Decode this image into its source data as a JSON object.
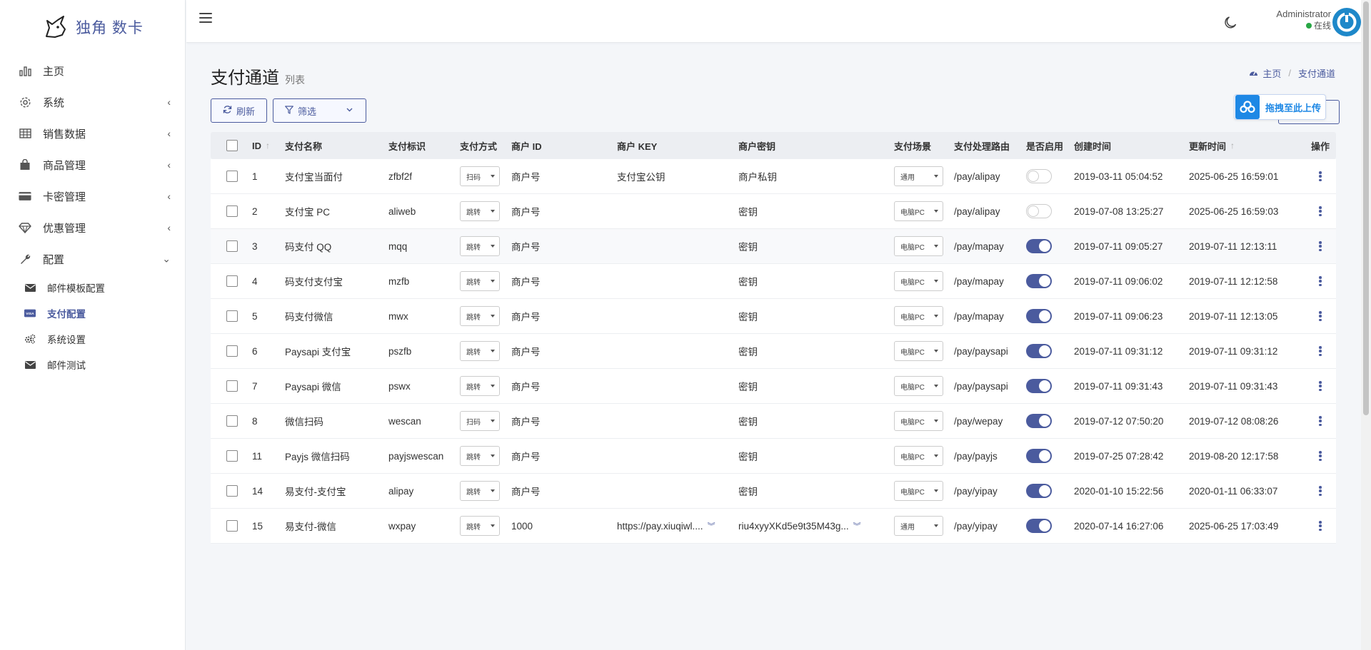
{
  "brand": {
    "name": "独角 数卡"
  },
  "sidebar": {
    "items": [
      {
        "label": "主页",
        "icon": "bar-chart-icon",
        "has_children": false
      },
      {
        "label": "系统",
        "icon": "gear-icon",
        "has_children": true
      },
      {
        "label": "销售数据",
        "icon": "table-icon",
        "has_children": true
      },
      {
        "label": "商品管理",
        "icon": "shopping-bag-icon",
        "has_children": true
      },
      {
        "label": "卡密管理",
        "icon": "credit-card-icon",
        "has_children": true
      },
      {
        "label": "优惠管理",
        "icon": "diamond-icon",
        "has_children": true
      },
      {
        "label": "配置",
        "icon": "wrench-icon",
        "has_children": true,
        "expanded": true
      }
    ],
    "sub_items": [
      {
        "label": "邮件模板配置",
        "icon": "envelope-icon"
      },
      {
        "label": "支付配置",
        "icon": "visa-card-icon",
        "active": true
      },
      {
        "label": "系统设置",
        "icon": "cogs-icon"
      },
      {
        "label": "邮件测试",
        "icon": "envelope-icon"
      }
    ]
  },
  "header": {
    "user_name": "Administrator",
    "user_status": "在线"
  },
  "page": {
    "title": "支付通道",
    "subtitle": "列表",
    "breadcrumb": {
      "home": "主页",
      "current": "支付通道"
    },
    "refresh_label": "刷新",
    "filter_label": "筛选",
    "upload_label": "拖拽至此上传"
  },
  "table": {
    "columns": {
      "id": "ID",
      "name": "支付名称",
      "ident": "支付标识",
      "method": "支付方式",
      "mid": "商户 ID",
      "mkey": "商户 KEY",
      "msec": "商户密钥",
      "scene": "支付场景",
      "route": "支付处理路由",
      "enabled": "是否启用",
      "created": "创建时间",
      "updated": "更新时间",
      "ops": "操作"
    },
    "rows": [
      {
        "id": "1",
        "name": "支付宝当面付",
        "ident": "zfbf2f",
        "method": "扫码",
        "mid": "商户号",
        "mkey": "支付宝公钥",
        "msec": "商户私钥",
        "scene": "通用",
        "route": "/pay/alipay",
        "enabled": false,
        "created": "2019-03-11 05:04:52",
        "updated": "2025-06-25 16:59:01"
      },
      {
        "id": "2",
        "name": "支付宝 PC",
        "ident": "aliweb",
        "method": "跳转",
        "mid": "商户号",
        "mkey": "",
        "msec": "密钥",
        "scene": "电脑PC",
        "route": "/pay/alipay",
        "enabled": false,
        "created": "2019-07-08 13:25:27",
        "updated": "2025-06-25 16:59:03"
      },
      {
        "id": "3",
        "name": "码支付 QQ",
        "ident": "mqq",
        "method": "跳转",
        "mid": "商户号",
        "mkey": "",
        "msec": "密钥",
        "scene": "电脑PC",
        "route": "/pay/mapay",
        "enabled": true,
        "created": "2019-07-11 09:05:27",
        "updated": "2019-07-11 12:13:11"
      },
      {
        "id": "4",
        "name": "码支付支付宝",
        "ident": "mzfb",
        "method": "跳转",
        "mid": "商户号",
        "mkey": "",
        "msec": "密钥",
        "scene": "电脑PC",
        "route": "/pay/mapay",
        "enabled": true,
        "created": "2019-07-11 09:06:02",
        "updated": "2019-07-11 12:12:58"
      },
      {
        "id": "5",
        "name": "码支付微信",
        "ident": "mwx",
        "method": "跳转",
        "mid": "商户号",
        "mkey": "",
        "msec": "密钥",
        "scene": "电脑PC",
        "route": "/pay/mapay",
        "enabled": true,
        "created": "2019-07-11 09:06:23",
        "updated": "2019-07-11 12:13:05"
      },
      {
        "id": "6",
        "name": "Paysapi 支付宝",
        "ident": "pszfb",
        "method": "跳转",
        "mid": "商户号",
        "mkey": "",
        "msec": "密钥",
        "scene": "电脑PC",
        "route": "/pay/paysapi",
        "enabled": true,
        "created": "2019-07-11 09:31:12",
        "updated": "2019-07-11 09:31:12"
      },
      {
        "id": "7",
        "name": "Paysapi 微信",
        "ident": "pswx",
        "method": "跳转",
        "mid": "商户号",
        "mkey": "",
        "msec": "密钥",
        "scene": "电脑PC",
        "route": "/pay/paysapi",
        "enabled": true,
        "created": "2019-07-11 09:31:43",
        "updated": "2019-07-11 09:31:43"
      },
      {
        "id": "8",
        "name": "微信扫码",
        "ident": "wescan",
        "method": "扫码",
        "mid": "商户号",
        "mkey": "",
        "msec": "密钥",
        "scene": "电脑PC",
        "route": "/pay/wepay",
        "enabled": true,
        "created": "2019-07-12 07:50:20",
        "updated": "2019-07-12 08:08:26"
      },
      {
        "id": "11",
        "name": "Payjs 微信扫码",
        "ident": "payjswescan",
        "method": "跳转",
        "mid": "商户号",
        "mkey": "",
        "msec": "密钥",
        "scene": "电脑PC",
        "route": "/pay/payjs",
        "enabled": true,
        "created": "2019-07-25 07:28:42",
        "updated": "2019-08-20 12:17:58"
      },
      {
        "id": "14",
        "name": "易支付-支付宝",
        "ident": "alipay",
        "method": "跳转",
        "mid": "商户号",
        "mkey": "",
        "msec": "密钥",
        "scene": "电脑PC",
        "route": "/pay/yipay",
        "enabled": true,
        "created": "2020-01-10 15:22:56",
        "updated": "2020-01-11 06:33:07"
      },
      {
        "id": "15",
        "name": "易支付-微信",
        "ident": "wxpay",
        "method": "跳转",
        "mid": "1000",
        "mkey": "https://pay.xiuqiwl....",
        "msec": "riu4xyyXKd5e9t35M43g...",
        "scene": "通用",
        "route": "/pay/yipay",
        "enabled": true,
        "created": "2020-07-14 16:27:06",
        "updated": "2025-06-25 17:03:49",
        "expandable": true
      }
    ]
  },
  "colors": {
    "accent": "#4b5b9e",
    "upload_blue": "#1e88e5",
    "online": "#28a745"
  }
}
